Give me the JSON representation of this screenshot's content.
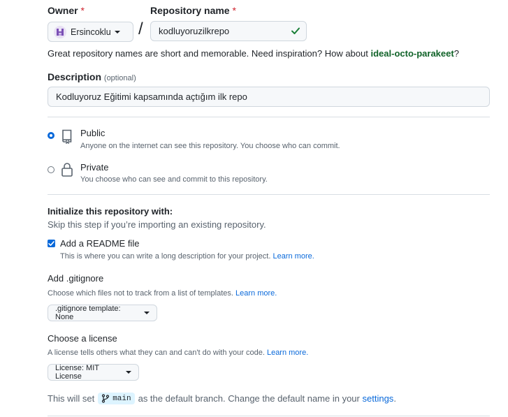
{
  "owner": {
    "label": "Owner",
    "required_mark": "*",
    "value": "Ersincoklu"
  },
  "repo_name": {
    "label": "Repository name",
    "required_mark": "*",
    "value": "kodluyoruzilkrepo"
  },
  "separator": "/",
  "name_hint": {
    "text": "Great repository names are short and memorable. Need inspiration? How about",
    "suggestion": "ideal-octo-parakeet",
    "end": "?"
  },
  "description": {
    "label": "Description",
    "optional": "(optional)",
    "value": "Kodluyoruz Eğitimi kapsamında açtığım ilk repo"
  },
  "visibility": {
    "public_title": "Public",
    "public_desc": "Anyone on the internet can see this repository. You choose who can commit.",
    "private_title": "Private",
    "private_desc": "You choose who can see and commit to this repository.",
    "selected": "public"
  },
  "init": {
    "heading": "Initialize this repository with:",
    "subtext": "Skip this step if you’re importing an existing repository.",
    "readme_label": "Add a README file",
    "readme_checked": true,
    "readme_desc": "This is where you can write a long description for your project.",
    "readme_link": "Learn more."
  },
  "gitignore": {
    "heading": "Add .gitignore",
    "desc": "Choose which files not to track from a list of templates.",
    "link": "Learn more.",
    "button": ".gitignore template: None"
  },
  "license": {
    "heading": "Choose a license",
    "desc": "A license tells others what they can and can't do with your code.",
    "link": "Learn more.",
    "button": "License: MIT License"
  },
  "branch": {
    "prefix": "This will set",
    "name": "main",
    "middle": "as the default branch. Change the default name in your",
    "link": "settings",
    "end": "."
  },
  "colors": {
    "link": "#0969da",
    "success": "#1a7f37",
    "suggestion": "#116329",
    "required": "#cf222e"
  }
}
